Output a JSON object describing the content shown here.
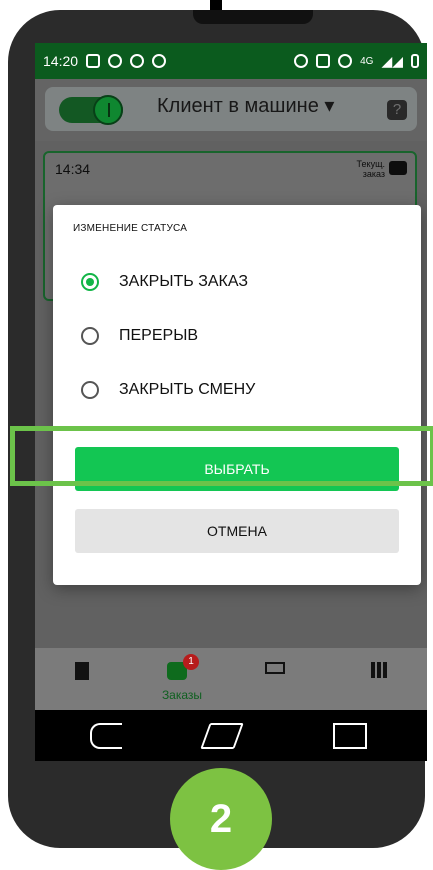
{
  "status_bar": {
    "time": "14:20",
    "network": "4G"
  },
  "topbar": {
    "title": "Клиент в машине ▾"
  },
  "order_card": {
    "time": "14:34",
    "current_label_line1": "Текущ.",
    "current_label_line2": "заказ"
  },
  "dialog": {
    "title": "ИЗМЕНЕНИЕ СТАТУСА",
    "options": [
      {
        "label": "ЗАКРЫТЬ ЗАКАЗ",
        "selected": true
      },
      {
        "label": "ПЕРЕРЫВ",
        "selected": false
      },
      {
        "label": "ЗАКРЫТЬ СМЕНУ",
        "selected": false
      }
    ],
    "primary_button": "ВЫБРАТЬ",
    "secondary_button": "ОТМЕНА"
  },
  "bottom_nav": {
    "orders_label": "Заказы",
    "orders_badge": "1"
  },
  "step_number": "2",
  "colors": {
    "accent_green": "#13c653",
    "dark_green": "#0b5b1e",
    "highlight": "#6cc34a"
  }
}
